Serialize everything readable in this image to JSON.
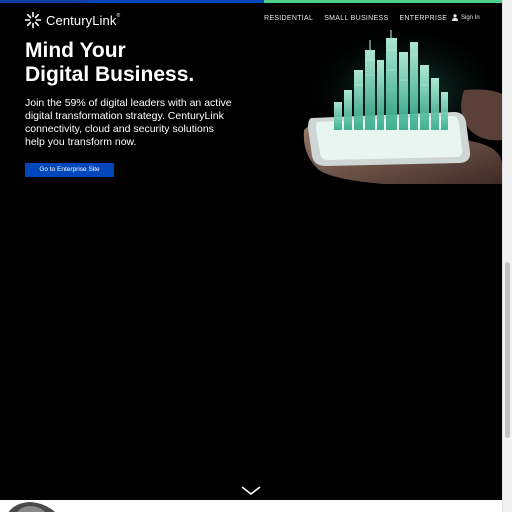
{
  "header": {
    "brand_name": "CenturyLink",
    "brand_mark": "®",
    "logo_icon": "starburst-logo-icon",
    "nav": [
      {
        "label": "RESIDENTIAL"
      },
      {
        "label": "SMALL BUSINESS"
      },
      {
        "label": "ENTERPRISE"
      }
    ],
    "signin": {
      "label": "Sign In",
      "icon": "user-icon"
    }
  },
  "hero": {
    "headline": [
      "Mind Your",
      "Digital Business."
    ],
    "subcopy": [
      "Join the 59% of digital leaders with an active",
      "digital transformation strategy. CenturyLink",
      "connectivity, cloud and security solutions",
      "help you transform now."
    ],
    "cta_label": "Go to Enterprise Site",
    "image": "hand-holding-phone-with-holographic-city"
  },
  "scroll_indicator": {
    "icon": "chevron-down-icon"
  },
  "colors": {
    "background": "#000000",
    "accent_blue": "#0047bb",
    "accent_green": "#4fd08b",
    "text": "#ffffff"
  }
}
